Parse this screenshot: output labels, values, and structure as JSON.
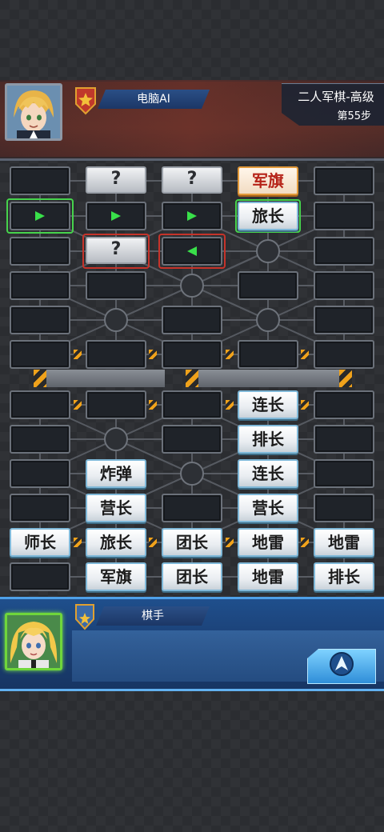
{
  "opponent": {
    "name": "电脑AI"
  },
  "game": {
    "title": "二人军棋-高级",
    "step": "第55步"
  },
  "player": {
    "name": "棋手"
  },
  "board": {
    "hidden_mark": "?",
    "pieces": [
      {
        "label": "军旗",
        "col": 3,
        "row": 0,
        "side": "red"
      },
      {
        "label": "旅长",
        "col": 3,
        "row": 1,
        "side": "blue"
      },
      {
        "label": "连长",
        "col": 3,
        "row": 6,
        "side": "blue"
      },
      {
        "label": "排长",
        "col": 3,
        "row": 7,
        "side": "blue"
      },
      {
        "label": "炸弹",
        "col": 1,
        "row": 8,
        "side": "blue"
      },
      {
        "label": "连长",
        "col": 3,
        "row": 8,
        "side": "blue"
      },
      {
        "label": "营长",
        "col": 1,
        "row": 9,
        "side": "blue"
      },
      {
        "label": "营长",
        "col": 3,
        "row": 9,
        "side": "blue"
      },
      {
        "label": "师长",
        "col": 0,
        "row": 10,
        "side": "blue"
      },
      {
        "label": "旅长",
        "col": 1,
        "row": 10,
        "side": "blue"
      },
      {
        "label": "团长",
        "col": 2,
        "row": 10,
        "side": "blue"
      },
      {
        "label": "地雷",
        "col": 3,
        "row": 10,
        "side": "blue"
      },
      {
        "label": "地雷",
        "col": 4,
        "row": 10,
        "side": "blue"
      },
      {
        "label": "军旗",
        "col": 1,
        "row": 11,
        "side": "blue"
      },
      {
        "label": "团长",
        "col": 2,
        "row": 11,
        "side": "blue"
      },
      {
        "label": "地雷",
        "col": 3,
        "row": 11,
        "side": "blue"
      },
      {
        "label": "排长",
        "col": 4,
        "row": 11,
        "side": "blue"
      }
    ],
    "hidden_pieces": [
      {
        "col": 1,
        "row": 0
      },
      {
        "col": 2,
        "row": 0
      },
      {
        "col": 1,
        "row": 2
      }
    ]
  },
  "colors": {
    "accent_blue": "#2a4f86",
    "highlight_green": "#46d34c",
    "highlight_red": "#c6332a"
  },
  "icons": {
    "rank_top": "rank-star-badge-icon",
    "rank_bottom": "rank-star-badge-icon",
    "action": "navigate-arrow-icon"
  }
}
